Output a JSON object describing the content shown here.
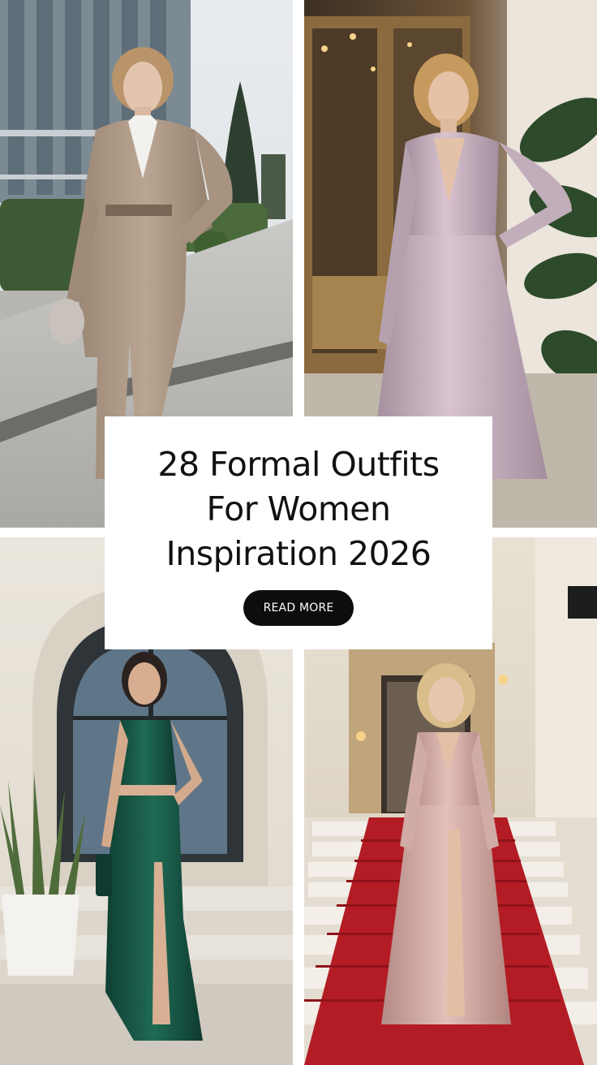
{
  "title": {
    "line1": "28 Formal Outfits",
    "line2": "For Women",
    "line3": "Inspiration 2026"
  },
  "cta": {
    "label": "READ MORE"
  },
  "photos": [
    {
      "subject": "woman in beige oversized suit on sidewalk"
    },
    {
      "subject": "woman in satin lilac two-piece dress by doors"
    },
    {
      "subject": "woman in emerald satin top and slit skirt at arched entrance"
    },
    {
      "subject": "woman in blush satin wrap gown on red-carpet stairs"
    }
  ],
  "colors": {
    "card_background": "#ffffff",
    "button_background": "#0d0d0d",
    "button_text": "#ffffff",
    "title_text": "#111111"
  }
}
